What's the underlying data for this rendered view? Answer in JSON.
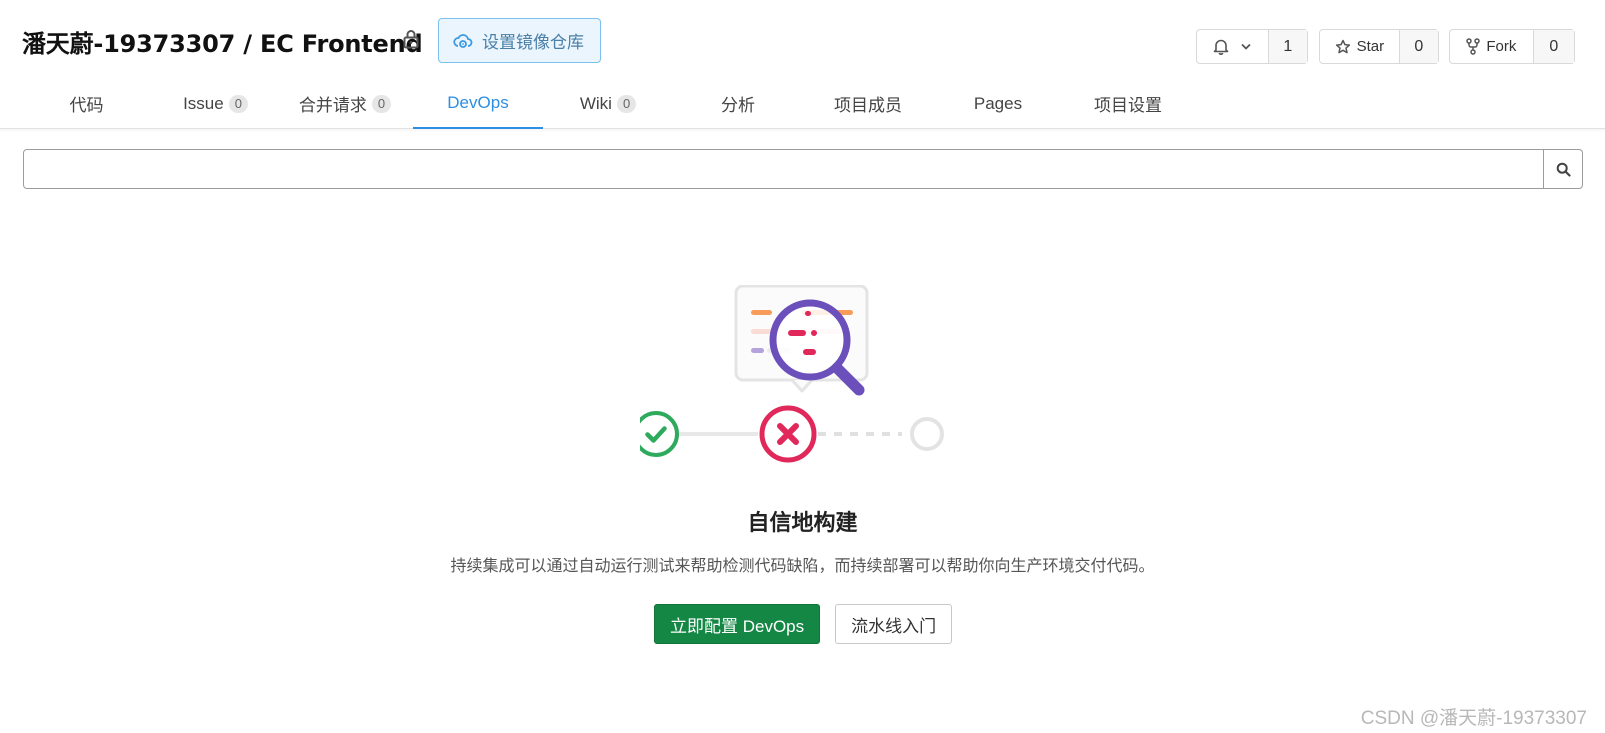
{
  "header": {
    "repo_title": "潘天蔚-19373307 / EC Frontend",
    "mirror_button_label": "设置镜像仓库",
    "watch": {
      "count": "1"
    },
    "star": {
      "label": "Star",
      "count": "0"
    },
    "fork": {
      "label": "Fork",
      "count": "0"
    },
    "icons": [
      "lock-icon",
      "cloud-gear-icon",
      "bell-icon",
      "chevron-down-icon",
      "star-icon",
      "fork-icon"
    ]
  },
  "tabs": [
    {
      "label": "代码"
    },
    {
      "label": "Issue",
      "badge": "0"
    },
    {
      "label": "合并请求",
      "badge": "0"
    },
    {
      "label": "DevOps",
      "active": true
    },
    {
      "label": "Wiki",
      "badge": "0"
    },
    {
      "label": "分析"
    },
    {
      "label": "项目成员"
    },
    {
      "label": "Pages"
    },
    {
      "label": "项目设置"
    }
  ],
  "search": {
    "value": "",
    "icon": "search-icon"
  },
  "empty_state": {
    "title": "自信地构建",
    "description": "持续集成可以通过自动运行测试来帮助检测代码缺陷，而持续部署可以帮助你向生产环境交付代码。",
    "primary_button": "立即配置 DevOps",
    "secondary_button": "流水线入门",
    "illustration_icons": [
      "document-icon",
      "magnifier-icon",
      "check-circle-icon",
      "error-circle-icon",
      "pending-circle-icon"
    ]
  },
  "watermark": "CSDN @潘天蔚-19373307",
  "colors": {
    "accent": "#2d8ee3",
    "primary_button": "#158745",
    "success": "#2eaa5c",
    "error": "#e0285a",
    "magnifier": "#6b4fbb"
  }
}
